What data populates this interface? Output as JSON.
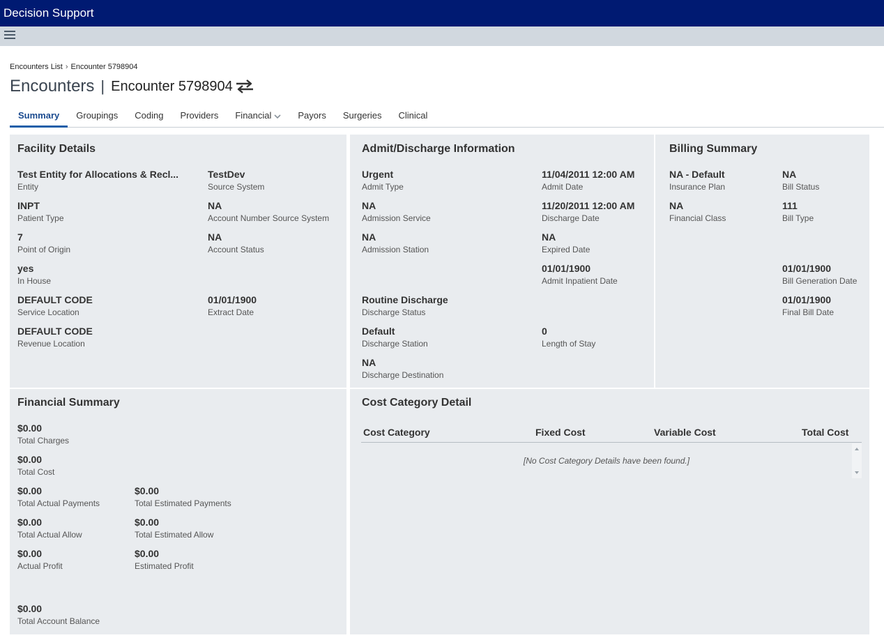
{
  "app": {
    "title": "Decision Support"
  },
  "breadcrumb": {
    "parent": "Encounters List",
    "separator": "›",
    "current": "Encounter 5798904"
  },
  "title": {
    "main": "Encounters",
    "divider": "|",
    "sub": "Encounter 5798904",
    "swap_icon": "swap-arrows-icon"
  },
  "tabs": [
    "Summary",
    "Groupings",
    "Coding",
    "Providers",
    "Financial",
    "Payors",
    "Surgeries",
    "Clinical"
  ],
  "facility": {
    "title": "Facility Details",
    "entity": {
      "value": "Test Entity for Allocations & Recl...",
      "label": "Entity"
    },
    "source_system": {
      "value": "TestDev",
      "label": "Source System"
    },
    "patient_type": {
      "value": "INPT",
      "label": "Patient Type"
    },
    "account_number_source_system": {
      "value": "NA",
      "label": "Account Number Source System"
    },
    "point_of_origin": {
      "value": "7",
      "label": "Point of Origin"
    },
    "account_status": {
      "value": "NA",
      "label": "Account Status"
    },
    "in_house": {
      "value": "yes",
      "label": "In House"
    },
    "service_location": {
      "value": "DEFAULT CODE",
      "label": "Service Location"
    },
    "extract_date": {
      "value": "01/01/1900",
      "label": "Extract Date"
    },
    "revenue_location": {
      "value": "DEFAULT CODE",
      "label": "Revenue Location"
    }
  },
  "admit": {
    "title": "Admit/Discharge Information",
    "admit_type": {
      "value": "Urgent",
      "label": "Admit Type"
    },
    "admit_date": {
      "value": "11/04/2011 12:00 AM",
      "label": "Admit Date"
    },
    "admission_service": {
      "value": "NA",
      "label": "Admission Service"
    },
    "discharge_date": {
      "value": "11/20/2011 12:00 AM",
      "label": "Discharge Date"
    },
    "admission_station": {
      "value": "NA",
      "label": "Admission Station"
    },
    "expired_date": {
      "value": "NA",
      "label": "Expired Date"
    },
    "admit_inpatient_date": {
      "value": "01/01/1900",
      "label": "Admit Inpatient Date"
    },
    "discharge_status": {
      "value": "Routine Discharge",
      "label": "Discharge Status"
    },
    "discharge_station": {
      "value": "Default",
      "label": "Discharge Station"
    },
    "length_of_stay": {
      "value": "0",
      "label": "Length of Stay"
    },
    "discharge_destination": {
      "value": "NA",
      "label": "Discharge Destination"
    }
  },
  "billing": {
    "title": "Billing Summary",
    "insurance_plan": {
      "value": "NA - Default",
      "label": "Insurance Plan"
    },
    "bill_status": {
      "value": "NA",
      "label": "Bill Status"
    },
    "financial_class": {
      "value": "NA",
      "label": "Financial Class"
    },
    "bill_type": {
      "value": "111",
      "label": "Bill Type"
    },
    "bill_generation_date": {
      "value": "01/01/1900",
      "label": "Bill Generation Date"
    },
    "final_bill_date": {
      "value": "01/01/1900",
      "label": "Final Bill Date"
    }
  },
  "financial": {
    "title": "Financial Summary",
    "total_charges": {
      "value": "$0.00",
      "label": "Total Charges"
    },
    "total_cost": {
      "value": "$0.00",
      "label": "Total Cost"
    },
    "total_actual_payments": {
      "value": "$0.00",
      "label": "Total Actual Payments"
    },
    "total_estimated_payments": {
      "value": "$0.00",
      "label": "Total Estimated Payments"
    },
    "total_actual_allow": {
      "value": "$0.00",
      "label": "Total Actual Allow"
    },
    "total_estimated_allow": {
      "value": "$0.00",
      "label": "Total Estimated Allow"
    },
    "actual_profit": {
      "value": "$0.00",
      "label": "Actual Profit"
    },
    "estimated_profit": {
      "value": "$0.00",
      "label": "Estimated Profit"
    },
    "total_account_balance": {
      "value": "$0.00",
      "label": "Total Account Balance"
    }
  },
  "cost_category": {
    "title": "Cost Category Detail",
    "columns": [
      "Cost Category",
      "Fixed Cost",
      "Variable Cost",
      "Total Cost"
    ],
    "empty_message": "[No Cost Category Details have been found.]"
  },
  "colors": {
    "header_bg": "#001a72",
    "toolbar_bg": "#d1d8df",
    "panel_bg": "#e9ecef",
    "active_tab": "#1a5ea8"
  }
}
